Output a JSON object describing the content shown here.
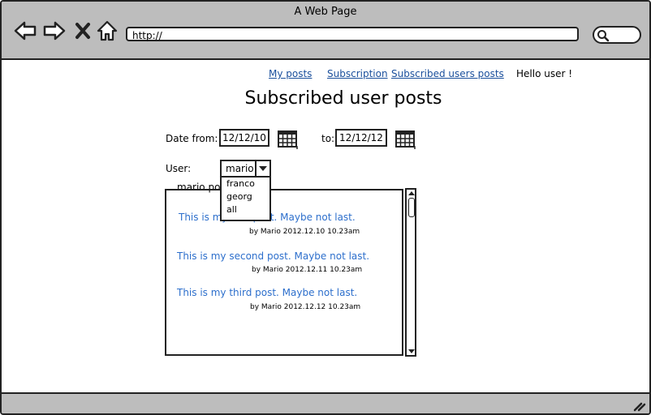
{
  "window": {
    "title": "A Web Page"
  },
  "browser": {
    "url": "http://"
  },
  "nav": {
    "my_posts": "My posts",
    "subscription": "Subscription",
    "subscribed_users_posts": "Subscribed users posts",
    "greeting": "Hello user !"
  },
  "page": {
    "heading": "Subscribed user posts"
  },
  "filters": {
    "date_from_label": "Date from:",
    "date_from": "12/12/10",
    "date_to_label": "to:",
    "date_to": "12/12/12",
    "user_label": "User:",
    "user_selected": "mario",
    "user_options": [
      "franco",
      "georg",
      "all"
    ]
  },
  "posts_panel": {
    "title": "mario posts"
  },
  "posts": [
    {
      "text": "This is my first post. Maybe not last.",
      "meta": "by Mario 2012.12.10 10.23am"
    },
    {
      "text": "This is my second post. Maybe not last.",
      "meta": "by Mario 2012.12.11 10.23am"
    },
    {
      "text": "This is my third post. Maybe not last.",
      "meta": "by Mario 2012.12.12 10.23am"
    }
  ],
  "colors": {
    "chrome": "#bdbdbd",
    "link": "#1a4f9c",
    "post_link": "#2d6fcc"
  }
}
